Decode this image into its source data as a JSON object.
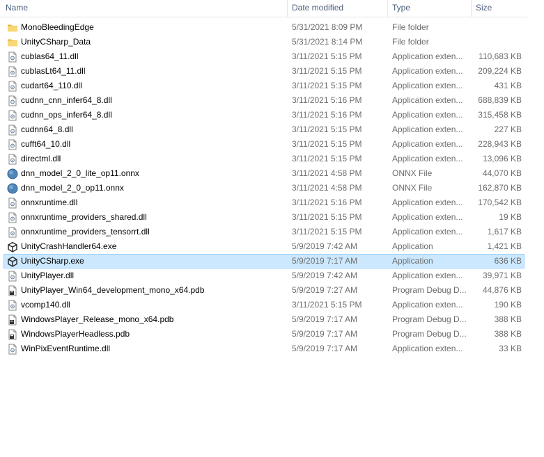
{
  "columns": {
    "name": "Name",
    "date": "Date modified",
    "type": "Type",
    "size": "Size"
  },
  "files": [
    {
      "name": "MonoBleedingEdge",
      "date": "5/31/2021 8:09 PM",
      "type": "File folder",
      "size": "",
      "icon": "folder-icon",
      "selected": false
    },
    {
      "name": "UnityCSharp_Data",
      "date": "5/31/2021 8:14 PM",
      "type": "File folder",
      "size": "",
      "icon": "folder-icon",
      "selected": false
    },
    {
      "name": "cublas64_11.dll",
      "date": "3/11/2021 5:15 PM",
      "type": "Application exten...",
      "size": "110,683 KB",
      "icon": "dll-file-icon",
      "selected": false
    },
    {
      "name": "cublasLt64_11.dll",
      "date": "3/11/2021 5:15 PM",
      "type": "Application exten...",
      "size": "209,224 KB",
      "icon": "dll-file-icon",
      "selected": false
    },
    {
      "name": "cudart64_110.dll",
      "date": "3/11/2021 5:15 PM",
      "type": "Application exten...",
      "size": "431 KB",
      "icon": "dll-file-icon",
      "selected": false
    },
    {
      "name": "cudnn_cnn_infer64_8.dll",
      "date": "3/11/2021 5:16 PM",
      "type": "Application exten...",
      "size": "688,839 KB",
      "icon": "dll-file-icon",
      "selected": false
    },
    {
      "name": "cudnn_ops_infer64_8.dll",
      "date": "3/11/2021 5:16 PM",
      "type": "Application exten...",
      "size": "315,458 KB",
      "icon": "dll-file-icon",
      "selected": false
    },
    {
      "name": "cudnn64_8.dll",
      "date": "3/11/2021 5:15 PM",
      "type": "Application exten...",
      "size": "227 KB",
      "icon": "dll-file-icon",
      "selected": false
    },
    {
      "name": "cufft64_10.dll",
      "date": "3/11/2021 5:15 PM",
      "type": "Application exten...",
      "size": "228,943 KB",
      "icon": "dll-file-icon",
      "selected": false
    },
    {
      "name": "directml.dll",
      "date": "3/11/2021 5:15 PM",
      "type": "Application exten...",
      "size": "13,096 KB",
      "icon": "dll-file-icon",
      "selected": false
    },
    {
      "name": "dnn_model_2_0_lite_op11.onnx",
      "date": "3/11/2021 4:58 PM",
      "type": "ONNX File",
      "size": "44,070 KB",
      "icon": "onnx-file-icon",
      "selected": false
    },
    {
      "name": "dnn_model_2_0_op11.onnx",
      "date": "3/11/2021 4:58 PM",
      "type": "ONNX File",
      "size": "162,870 KB",
      "icon": "onnx-file-icon",
      "selected": false
    },
    {
      "name": "onnxruntime.dll",
      "date": "3/11/2021 5:16 PM",
      "type": "Application exten...",
      "size": "170,542 KB",
      "icon": "dll-file-icon",
      "selected": false
    },
    {
      "name": "onnxruntime_providers_shared.dll",
      "date": "3/11/2021 5:15 PM",
      "type": "Application exten...",
      "size": "19 KB",
      "icon": "dll-file-icon",
      "selected": false
    },
    {
      "name": "onnxruntime_providers_tensorrt.dll",
      "date": "3/11/2021 5:15 PM",
      "type": "Application exten...",
      "size": "1,617 KB",
      "icon": "dll-file-icon",
      "selected": false
    },
    {
      "name": "UnityCrashHandler64.exe",
      "date": "5/9/2019 7:42 AM",
      "type": "Application",
      "size": "1,421 KB",
      "icon": "unity-app-icon",
      "selected": false
    },
    {
      "name": "UnityCSharp.exe",
      "date": "5/9/2019 7:17 AM",
      "type": "Application",
      "size": "636 KB",
      "icon": "unity-app-icon",
      "selected": true
    },
    {
      "name": "UnityPlayer.dll",
      "date": "5/9/2019 7:42 AM",
      "type": "Application exten...",
      "size": "39,971 KB",
      "icon": "dll-file-icon",
      "selected": false
    },
    {
      "name": "UnityPlayer_Win64_development_mono_x64.pdb",
      "date": "5/9/2019 7:27 AM",
      "type": "Program Debug D...",
      "size": "44,876 KB",
      "icon": "pdb-file-icon",
      "selected": false
    },
    {
      "name": "vcomp140.dll",
      "date": "3/11/2021 5:15 PM",
      "type": "Application exten...",
      "size": "190 KB",
      "icon": "dll-file-icon",
      "selected": false
    },
    {
      "name": "WindowsPlayer_Release_mono_x64.pdb",
      "date": "5/9/2019 7:17 AM",
      "type": "Program Debug D...",
      "size": "388 KB",
      "icon": "pdb-file-icon",
      "selected": false
    },
    {
      "name": "WindowsPlayerHeadless.pdb",
      "date": "5/9/2019 7:17 AM",
      "type": "Program Debug D...",
      "size": "388 KB",
      "icon": "pdb-file-icon",
      "selected": false
    },
    {
      "name": "WinPixEventRuntime.dll",
      "date": "5/9/2019 7:17 AM",
      "type": "Application exten...",
      "size": "33 KB",
      "icon": "dll-file-icon",
      "selected": false
    }
  ],
  "colors": {
    "header_text": "#4c607a",
    "meta_text": "#6d6d6d",
    "selection_bg": "#cce8ff",
    "selection_border": "#99d1ff",
    "folder": "#f5c94e"
  }
}
